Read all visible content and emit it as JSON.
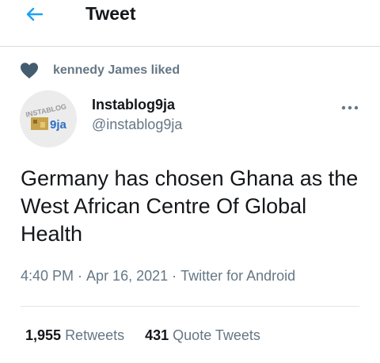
{
  "colors": {
    "accent": "#1da1f2",
    "primary_text": "#14171a",
    "secondary_text": "#657786",
    "heart_icon": "#445c6f",
    "divider": "#e1e5e8"
  },
  "header": {
    "title": "Tweet",
    "back_icon": "arrow-left-icon"
  },
  "social_context": {
    "icon": "heart-icon",
    "text": "kennedy James liked"
  },
  "tweet": {
    "author": {
      "name": "Instablog9ja",
      "handle": "@instablog9ja",
      "avatar_logo_text": "INSTABLOG 9ja"
    },
    "more_icon": "more-options-icon",
    "text": "Germany has chosen Ghana as the West African Centre Of Global Health",
    "time": "4:40 PM",
    "date": "Apr 16, 2021",
    "separator": "·",
    "source": "Twitter for Android"
  },
  "stats": {
    "retweets_count": "1,955",
    "retweets_label": "Retweets",
    "quote_tweets_count": "431",
    "quote_tweets_label": "Quote Tweets"
  }
}
